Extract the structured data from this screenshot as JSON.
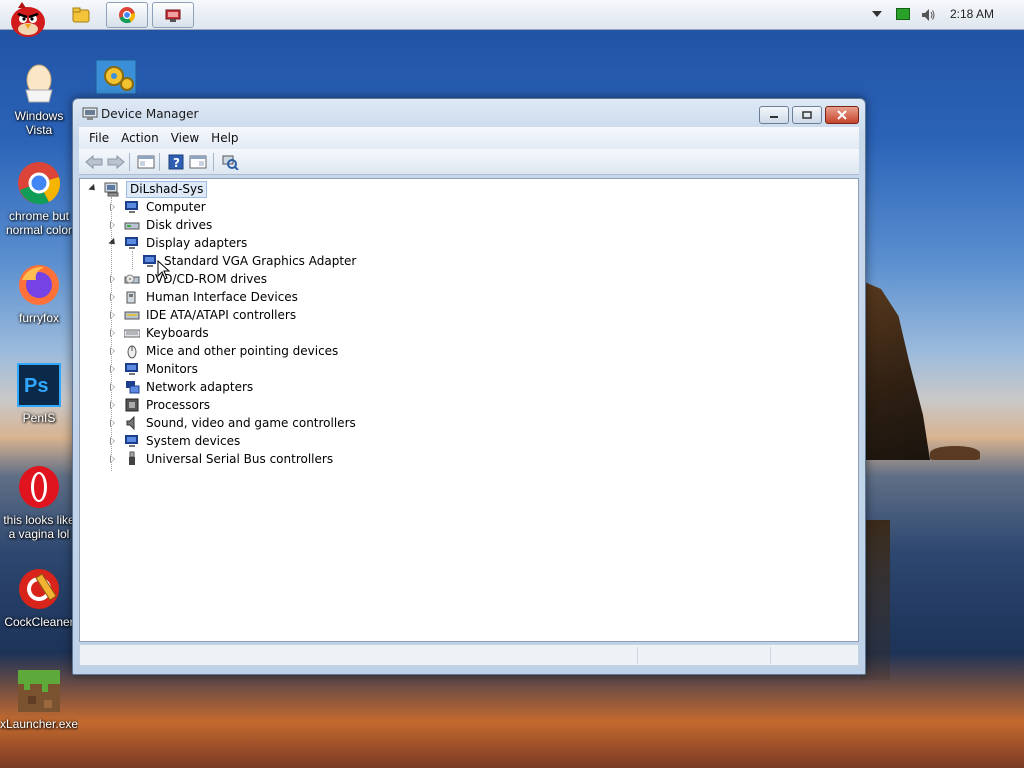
{
  "taskbar": {
    "clock": "2:18 AM",
    "buttons": [
      "chrome-taskbar",
      "device-manager-taskbar"
    ]
  },
  "desktop": {
    "icons": [
      {
        "label": "Windows Vista",
        "icon": "egg-icon"
      },
      {
        "label": "chrome but normal color",
        "icon": "chrome-icon"
      },
      {
        "label": "furryfox",
        "icon": "firefox-icon"
      },
      {
        "label": "PenIS",
        "icon": "photoshop-icon"
      },
      {
        "label": "this looks like a vagina lol",
        "icon": "opera-icon"
      },
      {
        "label": "CockCleaner",
        "icon": "ccleaner-icon"
      },
      {
        "label": "xLauncher.exe",
        "icon": "minecraft-icon"
      }
    ]
  },
  "window": {
    "title": "Device Manager",
    "menu": [
      "File",
      "Action",
      "View",
      "Help"
    ],
    "tree": {
      "root": "DiLshad-Sys",
      "items": [
        {
          "label": "Computer",
          "expanded": false
        },
        {
          "label": "Disk drives",
          "expanded": false
        },
        {
          "label": "Display adapters",
          "expanded": true,
          "children": [
            "Standard VGA Graphics Adapter"
          ]
        },
        {
          "label": "DVD/CD-ROM drives",
          "expanded": false
        },
        {
          "label": "Human Interface Devices",
          "expanded": false
        },
        {
          "label": "IDE ATA/ATAPI controllers",
          "expanded": false
        },
        {
          "label": "Keyboards",
          "expanded": false
        },
        {
          "label": "Mice and other pointing devices",
          "expanded": false
        },
        {
          "label": "Monitors",
          "expanded": false
        },
        {
          "label": "Network adapters",
          "expanded": false
        },
        {
          "label": "Processors",
          "expanded": false
        },
        {
          "label": "Sound, video and game controllers",
          "expanded": false
        },
        {
          "label": "System devices",
          "expanded": false
        },
        {
          "label": "Universal Serial Bus controllers",
          "expanded": false
        }
      ]
    }
  },
  "colors": {
    "selection": "#dde9f7",
    "close_button": "#c5432a",
    "window_frame": "#bed1e8"
  }
}
